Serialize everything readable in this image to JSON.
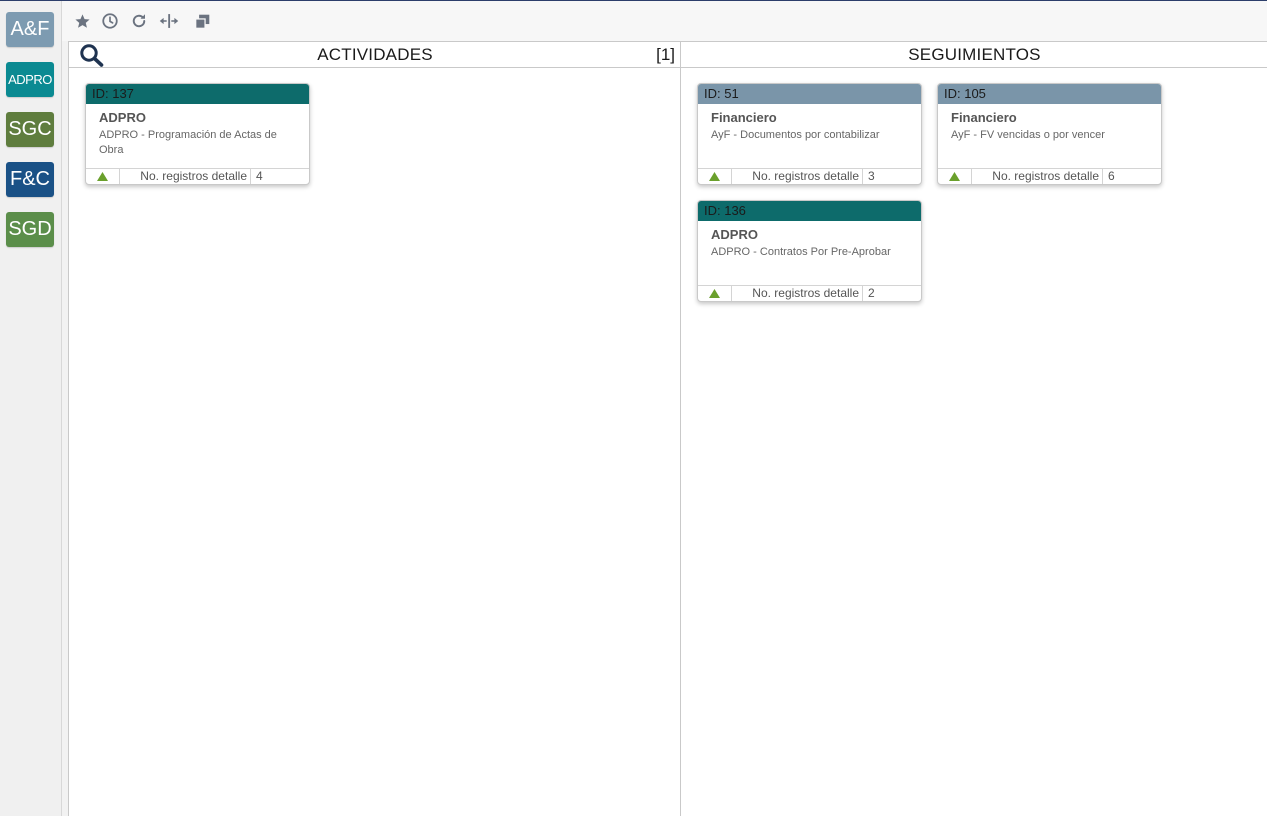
{
  "sidebar": {
    "apps": [
      {
        "label": "A&F",
        "color": "#7d9bb1"
      },
      {
        "label": "ADPRO",
        "color": "#0b8a92"
      },
      {
        "label": "SGC",
        "color": "#5f7d3e"
      },
      {
        "label": "F&C",
        "color": "#1a5186"
      },
      {
        "label": "SGD",
        "color": "#5b8e4a"
      }
    ]
  },
  "toolbar": {
    "icons": [
      "star-icon",
      "history-icon",
      "refresh-icon",
      "split-columns-icon",
      "windows-icon"
    ]
  },
  "actividades": {
    "title": "ACTIVIDADES",
    "count": "[1]",
    "cards": [
      {
        "id": "ID: 137",
        "title": "ADPRO",
        "desc": "ADPRO - Programación de Actas de Obra",
        "detail_label": "No. registros detalle",
        "detail_value": "4",
        "header_color": "#0d6b6b"
      }
    ]
  },
  "seguimientos": {
    "title": "SEGUIMIENTOS",
    "cards": [
      {
        "id": "ID: 51",
        "title": "Financiero",
        "desc": "AyF - Documentos por contabilizar",
        "detail_label": "No. registros detalle",
        "detail_value": "3",
        "header_color": "#7a95a9"
      },
      {
        "id": "ID: 105",
        "title": "Financiero",
        "desc": "AyF - FV vencidas o por vencer",
        "detail_label": "No. registros detalle",
        "detail_value": "6",
        "header_color": "#7a95a9"
      },
      {
        "id": "ID: 136",
        "title": "ADPRO",
        "desc": "ADPRO - Contratos Por Pre-Aprobar",
        "detail_label": "No. registros detalle",
        "detail_value": "2",
        "header_color": "#0d6b6b"
      }
    ]
  },
  "colors": {
    "arrow_green": "#6aa02c",
    "icon_gray": "#6b7380",
    "search_navy": "#1f3350"
  }
}
